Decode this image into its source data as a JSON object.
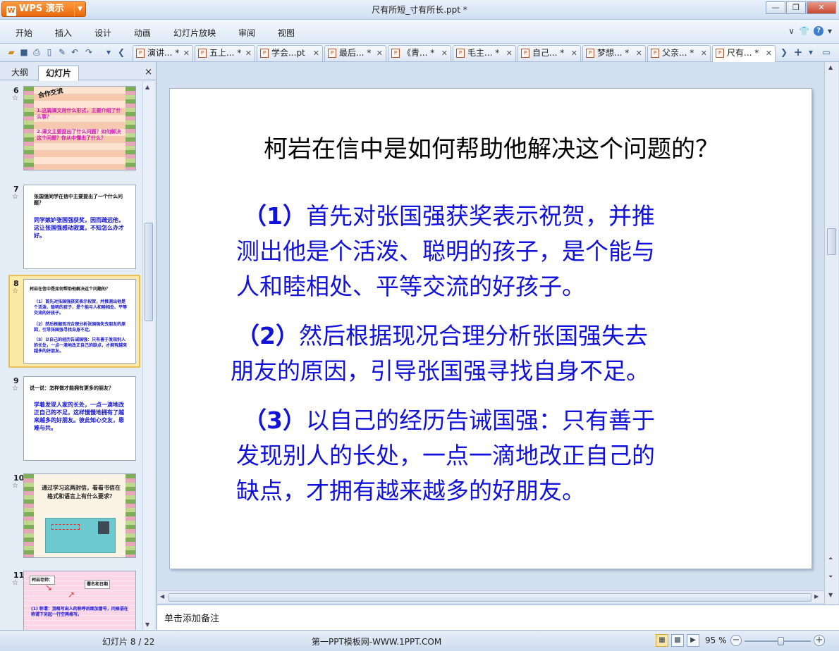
{
  "window": {
    "app_button": "WPS 演示",
    "title": "尺有所短_寸有所长.ppt *"
  },
  "menu": [
    "开始",
    "插入",
    "设计",
    "动画",
    "幻灯片放映",
    "审阅",
    "视图"
  ],
  "tabs": [
    {
      "label": "演讲... *"
    },
    {
      "label": "五上... *"
    },
    {
      "label": "学会...pt"
    },
    {
      "label": "最后... *"
    },
    {
      "label": "《青... *"
    },
    {
      "label": "毛主... *"
    },
    {
      "label": "自己... *"
    },
    {
      "label": "梦想... *"
    },
    {
      "label": "父亲... *"
    },
    {
      "label": "尺有... *"
    }
  ],
  "left_pane": {
    "tab_outline": "大纲",
    "tab_slides": "幻灯片",
    "close": "×",
    "slides": [
      {
        "num": "6",
        "title": "合作交流",
        "lines": [
          "1.这篇课文用什么形式，主要介绍了什么事？",
          "2.课文主要提出了什么问题？如何解决这个问题？你从中懂出了什么？"
        ]
      },
      {
        "num": "7",
        "title": "张国强同学在信中主要提出了一个什么问题？",
        "lines": [
          "同学嫉妒张国强获奖，因而疏远他，这让张国强感动寂寞，不知怎么办才好。"
        ]
      },
      {
        "num": "8",
        "title": "柯岩在信中是如何帮助他解决这个问题的？",
        "lines": [
          "（1）首先对张国强获奖表示祝贺，并推测出他是个活泼、聪明的孩子，是个能与人和睦相处、平等交流的好孩子。",
          "（2）然后根据现况合理分析张国强失去朋友的原因，引导张国强寻找自身不足。",
          "（3）以自己的经历告诫国强：只有善于发现别人的长处，一点一滴地改正自己的缺点，才拥有越来越多的好朋友。"
        ]
      },
      {
        "num": "9",
        "title": "说一说：怎样做才能拥有更多的朋友？",
        "lines": [
          "学着发现人家的长处，一点一滴地改正自己的不足，这样慢慢地拥有了越来越多的好朋友。彼此知心交友，患难与共。"
        ]
      },
      {
        "num": "10",
        "title": "通过学习这两封信，看看书信在格式和语言上有什么要求？",
        "lines": []
      },
      {
        "num": "11",
        "title": "柯岩老师：",
        "lines": [
          "署名和日期",
          "(1) 称谓：顶格写出人的称呼后面加冒号，问候语在称谓下另起一行空两格写。"
        ]
      }
    ]
  },
  "slide": {
    "title": "柯岩在信中是如何帮助他解决这个问题的？",
    "paragraphs": [
      {
        "num": "（1）",
        "text": "首先对张国强获奖表示祝贺，并推测出他是个活泼、聪明的孩子，是个能与人和睦相处、平等交流的好孩子。"
      },
      {
        "num": "（2）",
        "text": "然后根据现况合理分析张国强失去朋友的原因，引导张国强寻找自身不足。"
      },
      {
        "num": "（3）",
        "text": "以自己的经历告诫国强：只有善于发现别人的长处，一点一滴地改正自己的缺点，才拥有越来越多的好朋友。"
      }
    ],
    "lines": {
      "p1": [
        "首先对张国强获奖表示祝贺，并推",
        "测出他是个活泼、聪明的孩子，是个能与",
        "人和睦相处、平等交流的好孩子。"
      ],
      "p2": [
        "然后根据现况合理分析张国强失去",
        "朋友的原因，引导张国强寻找自身不足。"
      ],
      "p3": [
        "以自己的经历告诫国强：只有善于",
        "发现别人的长处，一点一滴地改正自己的",
        "缺点，才拥有越来越多的好朋友。"
      ]
    }
  },
  "notes_placeholder": "单击添加备注",
  "status": {
    "slide_info": "幻灯片 8 / 22",
    "center_text": "第一PPT模板网-WWW.1PPT.COM",
    "zoom": "95 %",
    "zoom_level": 0.55
  },
  "colors": {
    "slide_text_blue": "#1212d8",
    "wps_orange": "#e8690f",
    "selection": "#fbe9a8"
  }
}
